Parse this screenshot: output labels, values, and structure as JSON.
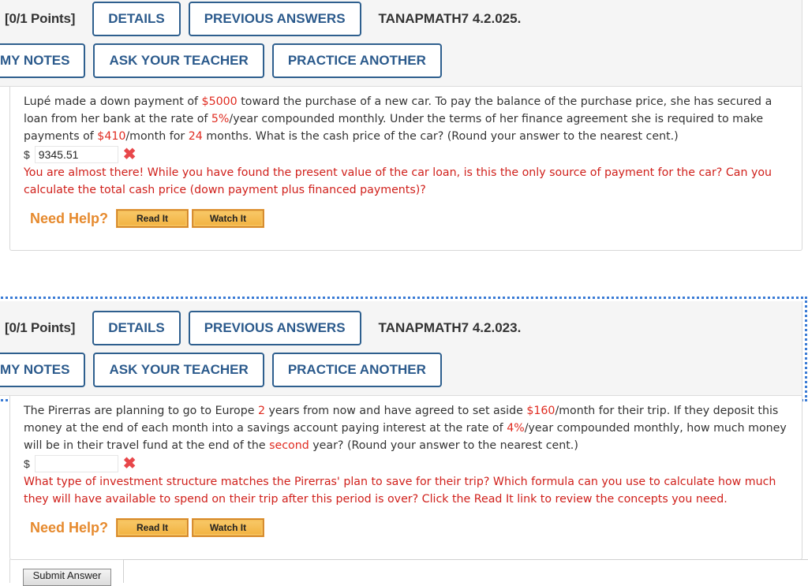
{
  "problems": [
    {
      "points": "[0/1 Points]",
      "details_label": "DETAILS",
      "previous_answers_label": "PREVIOUS ANSWERS",
      "question_id": "TANAPMATH7 4.2.025.",
      "my_notes_label": "MY NOTES",
      "ask_teacher_label": "ASK YOUR TEACHER",
      "practice_another_label": "PRACTICE ANOTHER",
      "question": {
        "t1": "Lupé made a down payment of ",
        "v1": "$5000",
        "t2": " toward the purchase of a new car. To pay the balance of the purchase price, she has secured a loan from her bank at the rate of ",
        "v2": "5%",
        "t3": "/year compounded monthly. Under the terms of her finance agreement she is required to make payments of ",
        "v3": "$410",
        "t4": "/month for ",
        "v4": "24",
        "t5": " months. What is the cash price of the car? (Round your answer to the nearest cent.)"
      },
      "currency_symbol": "$",
      "answer_value": "9345.51",
      "incorrect_mark": "✖",
      "feedback": "You are almost there! While you have found the present value of the car loan, is this the only source of payment for the car? Can you calculate the total cash price (down payment plus financed payments)?",
      "need_help_label": "Need Help?",
      "read_it_label": "Read It",
      "watch_it_label": "Watch It"
    },
    {
      "points": "[0/1 Points]",
      "details_label": "DETAILS",
      "previous_answers_label": "PREVIOUS ANSWERS",
      "question_id": "TANAPMATH7 4.2.023.",
      "my_notes_label": "MY NOTES",
      "ask_teacher_label": "ASK YOUR TEACHER",
      "practice_another_label": "PRACTICE ANOTHER",
      "question": {
        "t1": "The Pirerras are planning to go to Europe ",
        "v1": "2",
        "t2": " years from now and have agreed to set aside ",
        "v2": "$160",
        "t3": "/month for their trip. If they deposit this money at the end of each month into a savings account paying interest at the rate of ",
        "v3": "4%",
        "t4": "/year compounded monthly, how much money will be in their travel fund at the end of the ",
        "v4": "second",
        "t5": " year? (Round your answer to the nearest cent.)"
      },
      "currency_symbol": "$",
      "answer_value": "",
      "incorrect_mark": "✖",
      "feedback": "What type of investment structure matches the Pirerras' plan to save for their trip? Which formula can you use to calculate how much they will have available to spend on their trip after this period is over? Click the Read It link to review the concepts you need.",
      "need_help_label": "Need Help?",
      "read_it_label": "Read It",
      "watch_it_label": "Watch It",
      "submit_label": "Submit Answer"
    }
  ]
}
